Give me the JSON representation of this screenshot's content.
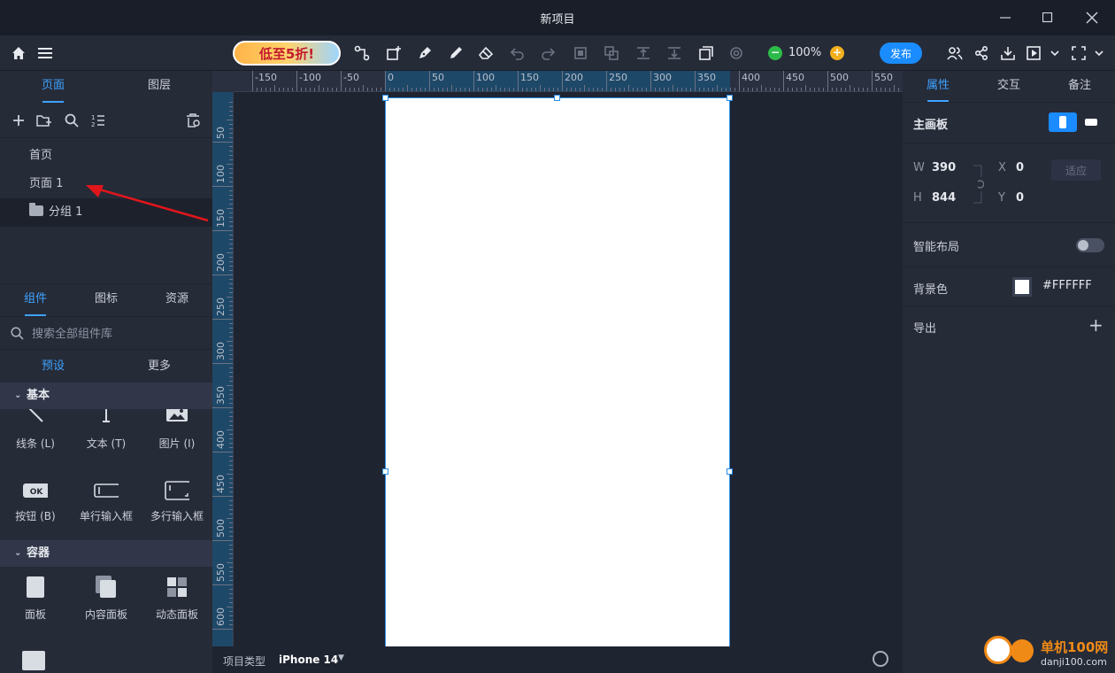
{
  "window": {
    "title": "新项目"
  },
  "toolbar": {
    "promo_text": "低至5折!",
    "zoom": "100%",
    "publish_label": "发布",
    "icons": [
      "home-icon",
      "menu-icon",
      "connector-icon",
      "add-frame-icon",
      "pen-icon",
      "pencil-icon",
      "eraser-icon",
      "undo-icon",
      "redo-icon",
      "group-icon",
      "ungroup-icon",
      "align-top-icon",
      "align-bottom-icon",
      "arrange-icon",
      "settings-icon",
      "collaborators-icon",
      "share-icon",
      "download-icon",
      "preview-icon",
      "fullscreen-icon"
    ]
  },
  "left_panel": {
    "tabs": [
      "页面",
      "图层"
    ],
    "active_tab": "页面",
    "pages": [
      {
        "label": "首页"
      },
      {
        "label": "页面 1"
      },
      {
        "label": "分组 1",
        "type": "folder"
      }
    ],
    "component_tabs": [
      "组件",
      "图标",
      "资源"
    ],
    "active_component_tab": "组件",
    "search_placeholder": "搜索全部组件库",
    "sub_tabs": [
      "预设",
      "更多"
    ],
    "active_sub_tab": "预设",
    "sections": [
      {
        "title": "基本",
        "items": [
          {
            "label": "线条 (L)",
            "icon": "line-icon"
          },
          {
            "label": "文本 (T)",
            "icon": "text-icon"
          },
          {
            "label": "图片 (I)",
            "icon": "image-icon"
          },
          {
            "label": "按钮 (B)",
            "icon": "button-icon",
            "icon_text": "OK"
          },
          {
            "label": "单行输入框",
            "icon": "single-input-icon"
          },
          {
            "label": "多行输入框",
            "icon": "multi-input-icon"
          }
        ]
      },
      {
        "title": "容器",
        "items": [
          {
            "label": "面板",
            "icon": "panel-icon"
          },
          {
            "label": "内容面板",
            "icon": "content-panel-icon"
          },
          {
            "label": "动态面板",
            "icon": "dynamic-panel-icon"
          }
        ]
      }
    ]
  },
  "canvas": {
    "ruler_top": [
      "-150",
      "-100",
      "-50",
      "0",
      "50",
      "100",
      "150",
      "200",
      "250",
      "300",
      "350",
      "400",
      "450",
      "500",
      "550"
    ],
    "ruler_left": [
      "50",
      "100",
      "150",
      "200",
      "250",
      "300",
      "350",
      "400",
      "450",
      "500",
      "550",
      "600"
    ],
    "status_label": "项目类型",
    "device": "iPhone 14"
  },
  "right_panel": {
    "tabs": [
      "属性",
      "交互",
      "备注"
    ],
    "active_tab": "属性",
    "artboard_label": "主画板",
    "w_label": "W",
    "w_value": "390",
    "h_label": "H",
    "h_value": "844",
    "x_label": "X",
    "x_value": "0",
    "y_label": "Y",
    "y_value": "0",
    "fit_label": "适应",
    "smart_layout_label": "智能布局",
    "smart_layout_on": false,
    "bg_label": "背景色",
    "bg_color": "#FFFFFF",
    "export_label": "导出"
  },
  "watermark": {
    "name": "单机100网",
    "url": "danji100.com"
  },
  "colors": {
    "accent": "#1a8cff",
    "panel": "#262b38",
    "canvas": "#1f2431",
    "annotation": "#e0161b"
  }
}
